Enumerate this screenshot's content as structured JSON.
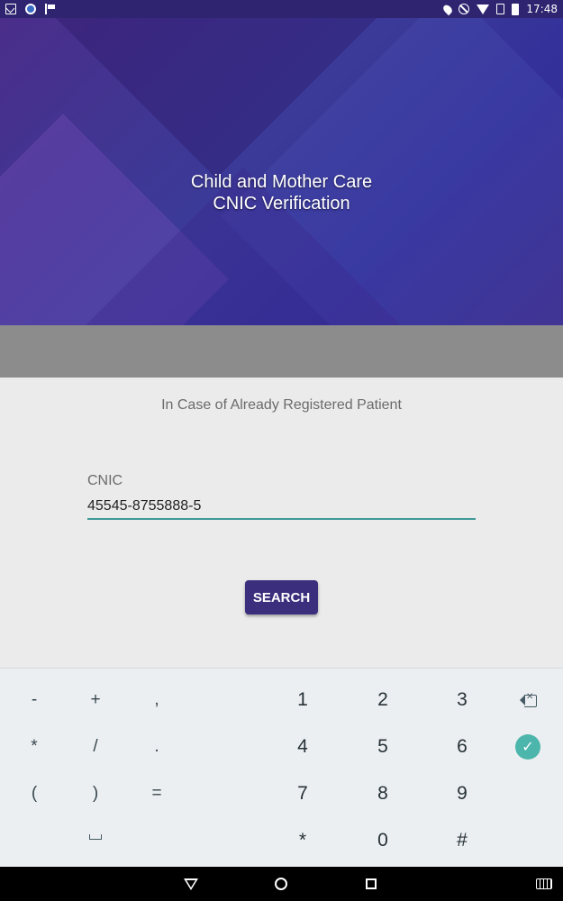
{
  "status_bar": {
    "time": "17:48",
    "left_icons": [
      "gmail-icon",
      "globe-icon",
      "flag-icon"
    ],
    "right_icons": [
      "location-icon",
      "do-not-disturb-icon",
      "wifi-icon",
      "sim-icon",
      "battery-icon"
    ]
  },
  "header": {
    "title_line1": "Child and Mother Care",
    "title_line2": "CNIC Verification",
    "colors": {
      "primary": "#3b2f7d"
    }
  },
  "form": {
    "subtitle": "In Case of Already Registered Patient",
    "cnic_label": "CNIC",
    "cnic_value": "45545-8755888-5",
    "search_label": "SEARCH",
    "accent_color": "#3f9a97"
  },
  "keyboard": {
    "rows": [
      [
        "-",
        "+",
        ",",
        "1",
        "2",
        "3",
        "backspace-icon"
      ],
      [
        "*",
        "/",
        ".",
        "4",
        "5",
        "6",
        "check-icon"
      ],
      [
        "(",
        ")",
        "=",
        "7",
        "8",
        "9",
        ""
      ],
      [
        "space-icon",
        "",
        "",
        "*",
        "0",
        "#",
        ""
      ]
    ],
    "r1": {
      "k1": "-",
      "k2": "+",
      "k3": ",",
      "k4": "1",
      "k5": "2",
      "k6": "3"
    },
    "r2": {
      "k1": "*",
      "k2": "/",
      "k3": ".",
      "k4": "4",
      "k5": "5",
      "k6": "6"
    },
    "r3": {
      "k1": "(",
      "k2": ")",
      "k3": "=",
      "k4": "7",
      "k5": "8",
      "k6": "9"
    },
    "r4": {
      "k4": "*",
      "k5": "0",
      "k6": "#"
    },
    "check_color": "#4db6ac"
  },
  "navbar": {
    "icons": [
      "back-icon",
      "home-icon",
      "recents-icon",
      "keyboard-icon"
    ]
  }
}
